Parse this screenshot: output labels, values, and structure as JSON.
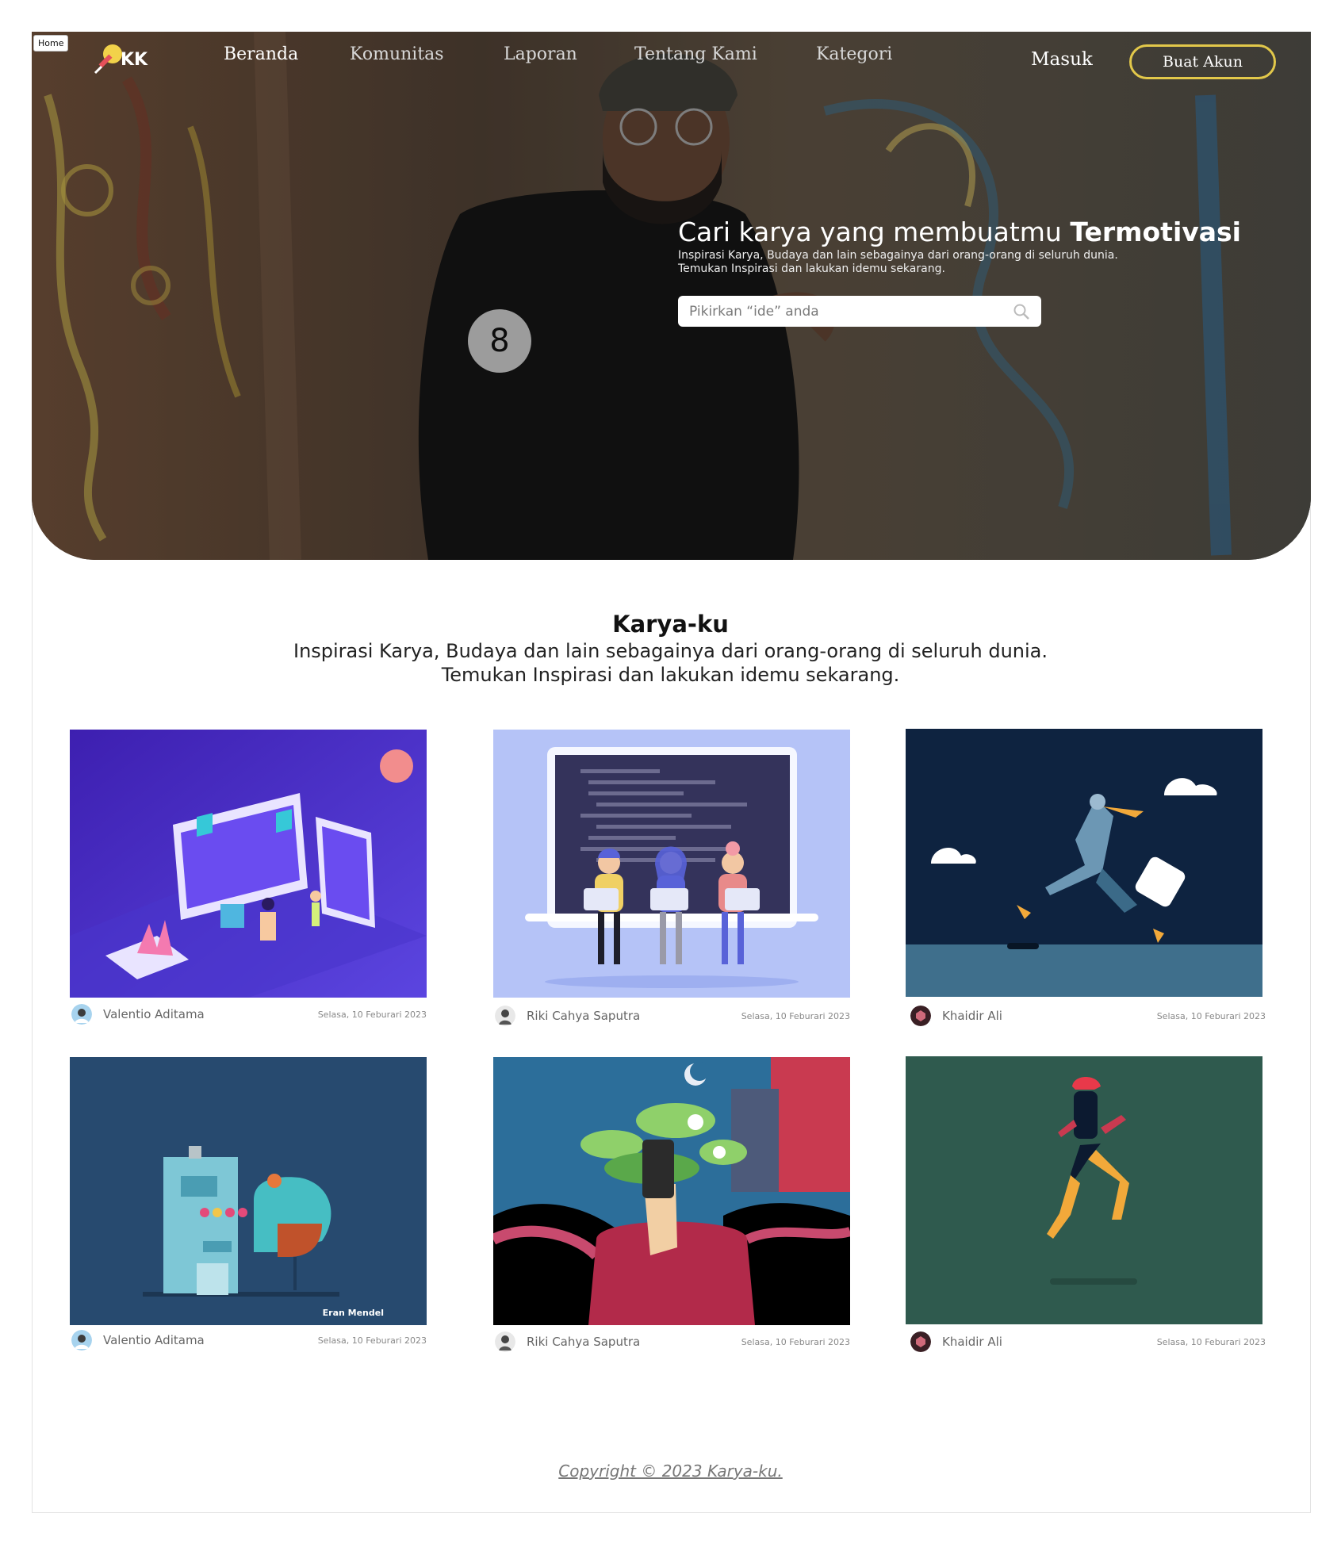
{
  "frame_tag": "Home",
  "brand": {
    "logo_text": "KK"
  },
  "nav": {
    "items": [
      {
        "label": "Beranda",
        "active": true
      },
      {
        "label": "Komunitas",
        "active": false
      },
      {
        "label": "Laporan",
        "active": false
      },
      {
        "label": "Tentang Kami",
        "active": false
      },
      {
        "label": "Kategori",
        "active": false
      }
    ],
    "login_label": "Masuk",
    "register_label": "Buat Akun"
  },
  "hero": {
    "title_prefix": "Cari karya yang membuatmu ",
    "title_emphasis": "Termotivasi",
    "subtitle_line1": "Inspirasi Karya, Budaya dan lain sebagainya dari orang-orang di seluruh dunia.",
    "subtitle_line2": "Temukan Inspirasi dan lakukan idemu sekarang.",
    "search_placeholder": "Pikirkan “ide” anda"
  },
  "section": {
    "title": "Karya-ku",
    "subtitle_line1": "Inspirasi Karya, Budaya dan lain sebagainya dari orang-orang di seluruh dunia.",
    "subtitle_line2": "Temukan Inspirasi dan lakukan idemu sekarang."
  },
  "cards": [
    {
      "author": "Valentio Aditama",
      "date": "Selasa, 10 Feburari 2023",
      "artwork": "isometric-dashboard-illustration"
    },
    {
      "author": "Riki Cahya Saputra",
      "date": "Selasa, 10 Feburari 2023",
      "artwork": "coders-on-bench-illustration"
    },
    {
      "author": "Khaidir Ali",
      "date": "Selasa, 10 Feburari 2023",
      "artwork": "running-delivery-man-illustration"
    },
    {
      "author": "Valentio Aditama",
      "date": "Selasa, 10 Feburari 2023",
      "artwork": "slot-machine-illustration",
      "signature": "Eran Mendel"
    },
    {
      "author": "Riki Cahya Saputra",
      "date": "Selasa, 10 Feburari 2023",
      "artwork": "phone-nature-head-illustration"
    },
    {
      "author": "Khaidir Ali",
      "date": "Selasa, 10 Feburari 2023",
      "artwork": "jumping-figure-illustration"
    }
  ],
  "footer": {
    "copyright": "Copyright © 2023 Karya-ku."
  },
  "colors": {
    "accent_border": "#e2c84a",
    "card1_bg": "#4a2fc4",
    "card2_bg": "#b4c4f8",
    "card3_bg": "#0e2340",
    "card4_bg": "#274a6f",
    "card6_bg": "#2f5a4e"
  }
}
